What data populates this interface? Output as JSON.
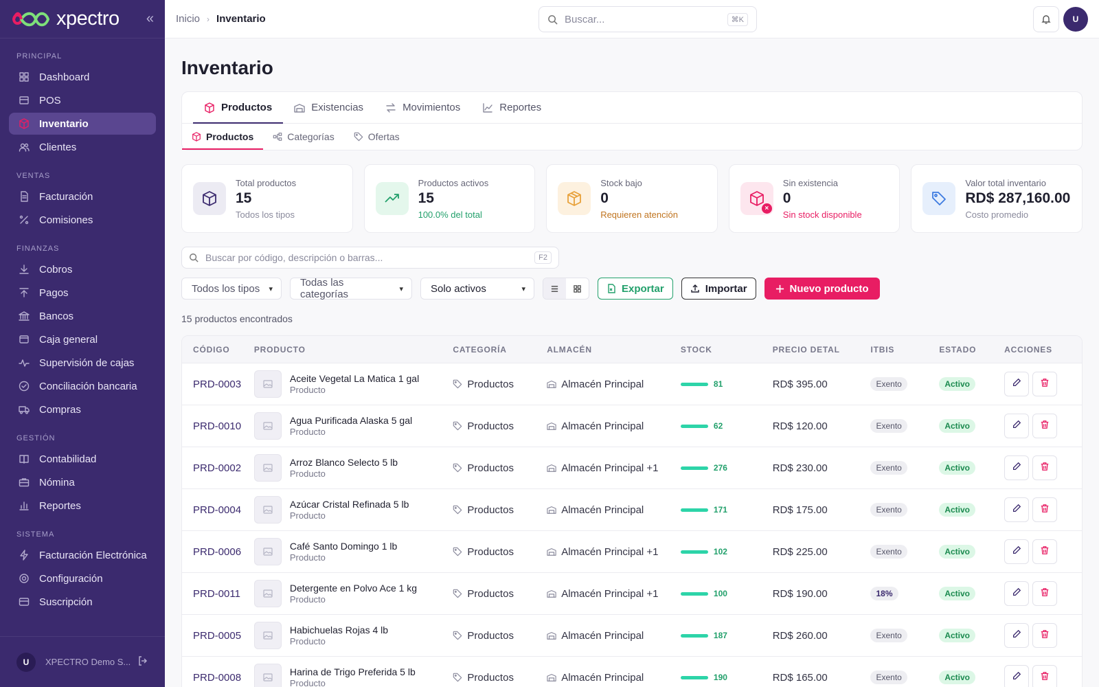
{
  "brand": {
    "name": "xpectro"
  },
  "sidebar": {
    "sections": [
      {
        "title": "PRINCIPAL",
        "items": [
          {
            "label": "Dashboard",
            "icon": "grid-icon",
            "active": false
          },
          {
            "label": "POS",
            "icon": "store-icon",
            "active": false
          },
          {
            "label": "Inventario",
            "icon": "box-icon",
            "active": true
          },
          {
            "label": "Clientes",
            "icon": "users-icon",
            "active": false
          }
        ]
      },
      {
        "title": "VENTAS",
        "items": [
          {
            "label": "Facturación",
            "icon": "file-icon",
            "active": false
          },
          {
            "label": "Comisiones",
            "icon": "percent-icon",
            "active": false
          }
        ]
      },
      {
        "title": "FINANZAS",
        "items": [
          {
            "label": "Cobros",
            "icon": "arrow-down-icon",
            "active": false
          },
          {
            "label": "Pagos",
            "icon": "arrow-up-icon",
            "active": false
          },
          {
            "label": "Bancos",
            "icon": "bank-icon",
            "active": false
          },
          {
            "label": "Caja general",
            "icon": "wallet-icon",
            "active": false
          },
          {
            "label": "Supervisión de cajas",
            "icon": "pulse-icon",
            "active": false
          },
          {
            "label": "Conciliación bancaria",
            "icon": "check-circle-icon",
            "active": false
          },
          {
            "label": "Compras",
            "icon": "truck-icon",
            "active": false
          }
        ]
      },
      {
        "title": "GESTIÓN",
        "items": [
          {
            "label": "Contabilidad",
            "icon": "book-icon",
            "active": false
          },
          {
            "label": "Nómina",
            "icon": "briefcase-icon",
            "active": false
          },
          {
            "label": "Reportes",
            "icon": "bar-chart-icon",
            "active": false
          }
        ]
      },
      {
        "title": "SISTEMA",
        "items": [
          {
            "label": "Facturación Electrónica",
            "icon": "bolt-icon",
            "active": false
          },
          {
            "label": "Configuración",
            "icon": "gear-icon",
            "active": false
          },
          {
            "label": "Suscripción",
            "icon": "card-icon",
            "active": false
          }
        ]
      }
    ],
    "footer": {
      "avatar": "U",
      "name": "XPECTRO Demo S..."
    }
  },
  "topbar": {
    "breadcrumb": [
      "Inicio",
      "Inventario"
    ],
    "search_placeholder": "Buscar...",
    "search_shortcut": "⌘K",
    "avatar": "U"
  },
  "page": {
    "title": "Inventario",
    "tabs": [
      {
        "label": "Productos",
        "icon": "box-icon",
        "active": true
      },
      {
        "label": "Existencias",
        "icon": "warehouse-icon",
        "active": false
      },
      {
        "label": "Movimientos",
        "icon": "swap-icon",
        "active": false
      },
      {
        "label": "Reportes",
        "icon": "line-chart-icon",
        "active": false
      }
    ],
    "subtabs": [
      {
        "label": "Productos",
        "icon": "box-icon",
        "active": true
      },
      {
        "label": "Categorías",
        "icon": "tree-icon",
        "active": false
      },
      {
        "label": "Ofertas",
        "icon": "tag-icon",
        "active": false
      }
    ]
  },
  "stats": [
    {
      "label": "Total productos",
      "value": "15",
      "sub": "Todos los tipos",
      "icon": "cube-icon",
      "bg": "#ecebf3",
      "fg": "#3b2a6e",
      "subColor": "#8a8a9c"
    },
    {
      "label": "Productos activos",
      "value": "15",
      "sub": "100.0% del total",
      "icon": "trend-up-icon",
      "bg": "#e4f7ec",
      "fg": "#22a06b",
      "subColor": "#22a06b"
    },
    {
      "label": "Stock bajo",
      "value": "0",
      "sub": "Requieren atención",
      "icon": "package-icon",
      "bg": "#fdf1df",
      "fg": "#e8a13a",
      "subColor": "#c0741f"
    },
    {
      "label": "Sin existencia",
      "value": "0",
      "sub": "Sin stock disponible",
      "icon": "box-x-icon",
      "bg": "#fde6ee",
      "fg": "#e81d63",
      "subColor": "#e81d63"
    },
    {
      "label": "Valor total inventario",
      "value": "RD$ 287,160.00",
      "sub": "Costo promedio",
      "icon": "price-tag-icon",
      "bg": "#e6effc",
      "fg": "#3d7be0",
      "subColor": "#8a8a9c"
    }
  ],
  "search": {
    "placeholder": "Buscar por código, descripción o barras...",
    "shortcut": "F2"
  },
  "filters": {
    "type": "Todos los tipos",
    "category": "Todas las categorías",
    "status": "Solo activos"
  },
  "actions": {
    "export": "Exportar",
    "import": "Importar",
    "new": "Nuevo producto"
  },
  "results_text": "15 productos encontrados",
  "table": {
    "headers": [
      "CÓDIGO",
      "PRODUCTO",
      "CATEGORÍA",
      "ALMACÉN",
      "STOCK",
      "PRECIO DETAL",
      "ITBIS",
      "ESTADO",
      "ACCIONES"
    ],
    "rows": [
      {
        "code": "PRD-0003",
        "name": "Aceite Vegetal La Matica 1 gal",
        "type": "Producto",
        "category": "Productos",
        "warehouse": "Almacén Principal",
        "stock": "81",
        "price": "RD$ 395.00",
        "itbis": "Exento",
        "status": "Activo"
      },
      {
        "code": "PRD-0010",
        "name": "Agua Purificada Alaska 5 gal",
        "type": "Producto",
        "category": "Productos",
        "warehouse": "Almacén Principal",
        "stock": "62",
        "price": "RD$ 120.00",
        "itbis": "Exento",
        "status": "Activo"
      },
      {
        "code": "PRD-0002",
        "name": "Arroz Blanco Selecto 5 lb",
        "type": "Producto",
        "category": "Productos",
        "warehouse": "Almacén Principal +1",
        "stock": "276",
        "price": "RD$ 230.00",
        "itbis": "Exento",
        "status": "Activo"
      },
      {
        "code": "PRD-0004",
        "name": "Azúcar Cristal Refinada 5 lb",
        "type": "Producto",
        "category": "Productos",
        "warehouse": "Almacén Principal",
        "stock": "171",
        "price": "RD$ 175.00",
        "itbis": "Exento",
        "status": "Activo"
      },
      {
        "code": "PRD-0006",
        "name": "Café Santo Domingo 1 lb",
        "type": "Producto",
        "category": "Productos",
        "warehouse": "Almacén Principal +1",
        "stock": "102",
        "price": "RD$ 225.00",
        "itbis": "Exento",
        "status": "Activo"
      },
      {
        "code": "PRD-0011",
        "name": "Detergente en Polvo Ace 1 kg",
        "type": "Producto",
        "category": "Productos",
        "warehouse": "Almacén Principal +1",
        "stock": "100",
        "price": "RD$ 190.00",
        "itbis": "18%",
        "status": "Activo"
      },
      {
        "code": "PRD-0005",
        "name": "Habichuelas Rojas 4 lb",
        "type": "Producto",
        "category": "Productos",
        "warehouse": "Almacén Principal",
        "stock": "187",
        "price": "RD$ 260.00",
        "itbis": "Exento",
        "status": "Activo"
      },
      {
        "code": "PRD-0008",
        "name": "Harina de Trigo Preferida 5 lb",
        "type": "Producto",
        "category": "Productos",
        "warehouse": "Almacén Principal",
        "stock": "190",
        "price": "RD$ 165.00",
        "itbis": "Exento",
        "status": "Activo"
      }
    ]
  }
}
